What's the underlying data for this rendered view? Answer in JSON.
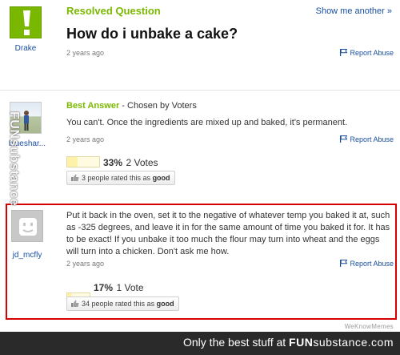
{
  "question": {
    "status": "Resolved Question",
    "show_another": "Show me another »",
    "title": "How do i unbake a cake?",
    "user": "Drake",
    "time": "2 years ago",
    "report": "Report Abuse"
  },
  "best_answer": {
    "label": "Best Answer",
    "chosen_by": " - Chosen by Voters",
    "user": "blueshar...",
    "text": "You can't. Once the ingredients are mixed up and baked, it's permanent.",
    "time": "2 years ago",
    "report": "Report Abuse",
    "vote_pct": "33%",
    "vote_fraction": 0.33,
    "vote_count": "2 Votes",
    "rated_prefix": "3 people rated this as ",
    "rated_word": "good"
  },
  "answer2": {
    "user": "jd_mcfly",
    "text": "Put it back in the oven, set it to the negative of whatever temp you baked it at, such as -325 degrees, and leave it in for the same amount of time you baked it for. It has to be exact! If you unbake it too much the flour may turn into wheat and the eggs will turn into a chicken. Don't ask me how.",
    "time": "2 years ago",
    "report": "Report Abuse",
    "vote_pct": "17%",
    "vote_fraction": 0.17,
    "vote_count": "1 Vote",
    "rated_prefix": "34 people rated this as ",
    "rated_word": "good"
  },
  "watermarks": {
    "side": "FUNsubstance",
    "wekn": "WeKnowMemes",
    "footer_prefix": "Only the best stuff at ",
    "footer_brand": "FUN",
    "footer_brand_sub": "substance",
    "footer_suffix": ".com"
  },
  "colors": {
    "accent_green": "#7ab800",
    "link_blue": "#1a4fa0",
    "highlight_red": "#d60000"
  },
  "icons": [
    "exclamation-icon",
    "flag-icon",
    "thumbs-up-icon"
  ]
}
